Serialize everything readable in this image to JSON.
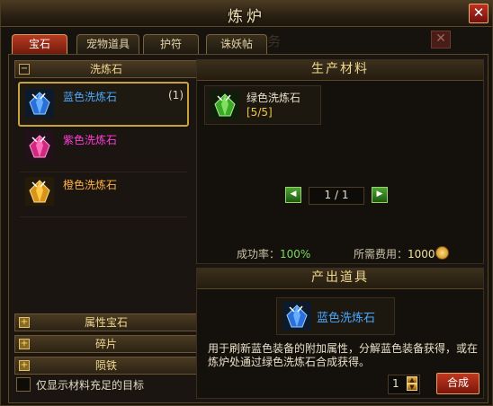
{
  "window": {
    "title": "炼炉",
    "close_glyph": "✕"
  },
  "tabs": [
    {
      "label": "宝石"
    },
    {
      "label": "宠物道具"
    },
    {
      "label": "护符"
    },
    {
      "label": "诛妖帖"
    }
  ],
  "background_text": "务",
  "left": {
    "open_category": "洗炼石",
    "items": [
      {
        "name": "蓝色洗炼石",
        "count": "(1)",
        "color": "#4aa8ff"
      },
      {
        "name": "紫色洗炼石",
        "color": "#ff3cd8"
      },
      {
        "name": "橙色洗炼石",
        "color": "#ffb040"
      }
    ],
    "categories": [
      "属性宝石",
      "碎片",
      "陨铁"
    ],
    "checkbox_label": "仅显示材料充足的目标"
  },
  "materials": {
    "heading": "生产材料",
    "item_name": "绿色洗炼石",
    "item_count": "[5/5]",
    "page": "1 / 1",
    "rate_label": "成功率：",
    "rate_value": "100%",
    "fee_label": "所需费用：",
    "fee_value": "1000"
  },
  "output": {
    "heading": "产出道具",
    "item_name": "蓝色洗炼石",
    "description": "用于刷新蓝色装备的附加属性，分解蓝色装备获得，或在炼炉处通过绿色洗炼石合成获得。",
    "quantity": "1",
    "synth_label": "合成"
  }
}
